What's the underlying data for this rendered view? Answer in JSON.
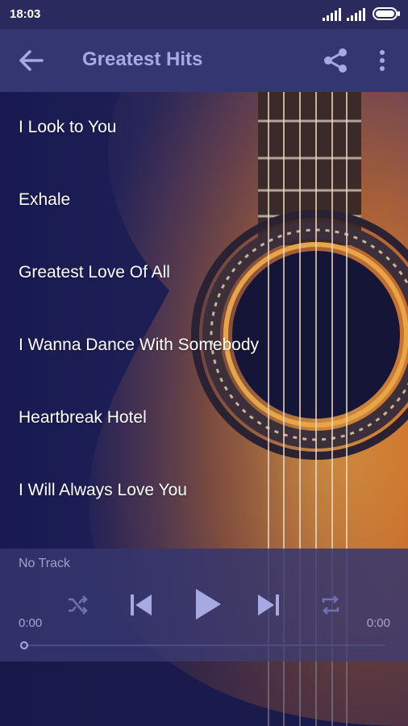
{
  "status_bar": {
    "time": "18:03",
    "icons": [
      "signal-icon",
      "signal-icon",
      "battery-icon"
    ]
  },
  "app_bar": {
    "title": "Greatest Hits",
    "icons": [
      "back-arrow-icon",
      "share-icon",
      "more-vert-icon"
    ]
  },
  "tracks": [
    "I Look to You",
    "Exhale",
    "Greatest Love Of All",
    "I Wanna Dance With Somebody",
    "Heartbreak Hotel",
    "I Will Always Love You"
  ],
  "player": {
    "track_name": "No Track",
    "elapsed": "0:00",
    "duration": "0:00",
    "progress_fraction": 0,
    "controls": [
      "shuffle-icon",
      "previous-icon",
      "play-icon",
      "next-icon",
      "repeat-icon"
    ]
  },
  "colors": {
    "status_bar": "#2a2a5e",
    "app_bar": "#343672",
    "title_text": "#a6a9e2",
    "player_panel": "#34366e",
    "track_text": "#ffffff"
  }
}
